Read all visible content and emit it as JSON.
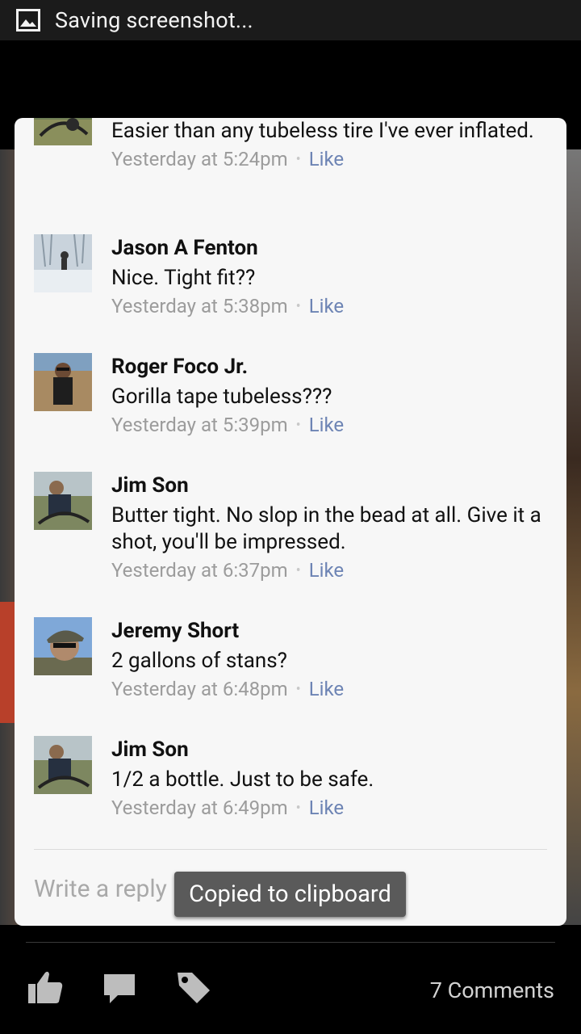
{
  "status_bar": {
    "text": "Saving screenshot..."
  },
  "comments": [
    {
      "name": "",
      "text": "Easier than any tubeless tire I've ever inflated.",
      "time": "Yesterday at 5:24pm",
      "like": "Like"
    },
    {
      "name": "Jason A Fenton",
      "text": "Nice.  Tight fit??",
      "time": "Yesterday at 5:38pm",
      "like": "Like"
    },
    {
      "name": "Roger Foco Jr.",
      "text": "Gorilla tape tubeless???",
      "time": "Yesterday at 5:39pm",
      "like": "Like"
    },
    {
      "name": "Jim Son",
      "text": "Butter tight. No slop in the bead at all. Give it a shot, you'll be impressed.",
      "time": "Yesterday at 6:37pm",
      "like": "Like"
    },
    {
      "name": "Jeremy Short",
      "text": "2 gallons of stans?",
      "time": "Yesterday at 6:48pm",
      "like": "Like"
    },
    {
      "name": "Jim Son",
      "text": "1/2 a bottle. Just to be safe.",
      "time": "Yesterday at 6:49pm",
      "like": "Like"
    }
  ],
  "reply": {
    "placeholder": "Write a reply"
  },
  "toast": {
    "text": "Copied to clipboard"
  },
  "bottom": {
    "comments_count": "7 Comments"
  },
  "colors": {
    "link": "#6d84b4",
    "meta": "#9c9c9c",
    "card": "#f7f7f7"
  }
}
